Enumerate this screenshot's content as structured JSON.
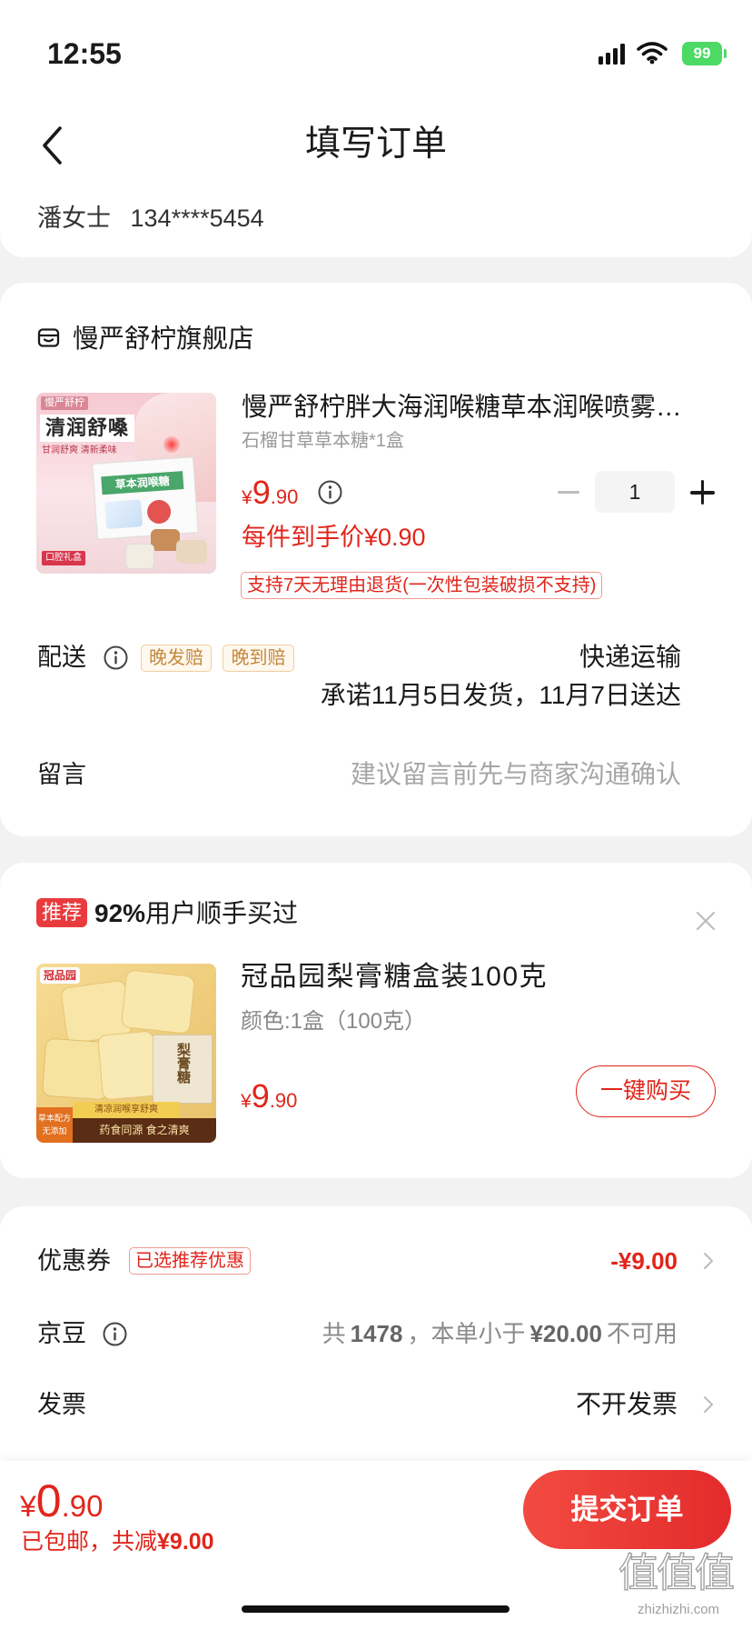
{
  "status_bar": {
    "time": "12:55",
    "battery": "99"
  },
  "header": {
    "title": "填写订单"
  },
  "address": {
    "name": "潘女士",
    "phone": "134****5454"
  },
  "store": {
    "name": "慢严舒柠旗舰店",
    "product": {
      "title": "慢严舒柠胖大海润喉糖草本润喉喷雾…",
      "spec": "石榴甘草草本糖*1盒",
      "price_symbol": "¥",
      "price_int": "9",
      "price_dec": ".90",
      "quantity": "1",
      "unit_price": "每件到手价¥0.90",
      "return_tag": "支持7天无理由退货(一次性包装破损不支持)",
      "image_text": {
        "brand": "慢严舒柠",
        "headline": "清润舒嗓",
        "tagline": "甘润舒爽 清新柔味",
        "box_label": "草本润喉糖",
        "gift": "口腔礼盒"
      }
    },
    "delivery": {
      "label": "配送",
      "tags": [
        "晚发赔",
        "晚到赔"
      ],
      "method": "快递运输",
      "promise": "承诺11月5日发货，11月7日送达"
    },
    "message": {
      "label": "留言",
      "placeholder": "建议留言前先与商家沟通确认"
    }
  },
  "recommend": {
    "badge": "推荐",
    "pct": "92%",
    "text": "用户顺手买过",
    "product": {
      "title": "冠品园梨膏糖盒装100克",
      "spec": "颜色:1盒（100克）",
      "price_symbol": "¥",
      "price_int": "9",
      "price_dec": ".90",
      "buy_label": "一键购买",
      "image_text": {
        "logo": "冠品园",
        "box_label": "梨膏糖",
        "band": "清凉润喉享舒爽",
        "badge_line1": "草本配方",
        "badge_line2": "无添加",
        "bottom_band": "药食同源 食之清爽"
      }
    }
  },
  "summary": {
    "coupon": {
      "label": "优惠券",
      "tag": "已选推荐优惠",
      "value": "-¥9.00"
    },
    "beans": {
      "label": "京豆",
      "prefix": "共",
      "count": "1478",
      "middle": "，本单小于",
      "threshold": "¥20.00",
      "suffix": "不可用"
    },
    "invoice": {
      "label": "发票",
      "value": "不开发票"
    }
  },
  "bottom": {
    "price_symbol": "¥",
    "price_int": "0",
    "price_dec": ".90",
    "note_prefix": "已包邮，共减",
    "note_amount": "¥9.00",
    "submit": "提交订单"
  },
  "watermark": {
    "glyphs": "值值值",
    "url": "zhizhizhi.com"
  },
  "colors": {
    "accent": "#e1251b",
    "submit_gradient": [
      "#f24b41",
      "#e32b2b"
    ],
    "battery": "#4cd964",
    "page_bg": "#f2f2f2"
  },
  "icons": [
    "signal-icon",
    "wifi-icon",
    "battery-icon",
    "chevron-left-icon",
    "store-icon",
    "info-icon",
    "minus-icon",
    "plus-icon",
    "close-icon",
    "chevron-right-icon"
  ]
}
